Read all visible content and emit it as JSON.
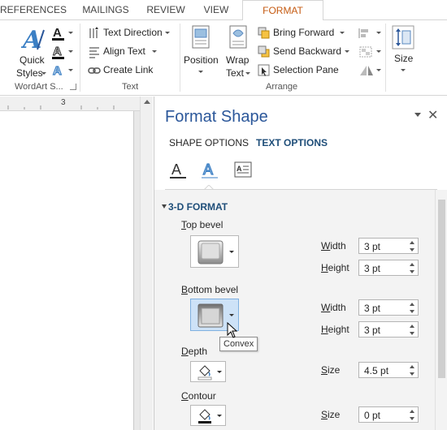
{
  "tabs": [
    {
      "label": "REFERENCES",
      "active": false
    },
    {
      "label": "MAILINGS",
      "active": false
    },
    {
      "label": "REVIEW",
      "active": false
    },
    {
      "label": "VIEW",
      "active": false
    },
    {
      "label": "FORMAT",
      "active": true
    }
  ],
  "ribbon": {
    "wordart": {
      "quick_styles_line1": "Quick",
      "quick_styles_line2": "Styles",
      "group_label": "WordArt S..."
    },
    "text": {
      "text_direction": "Text Direction",
      "align_text": "Align Text",
      "create_link": "Create Link",
      "group_label": "Text"
    },
    "arrange": {
      "position": "Position",
      "wrap_line1": "Wrap",
      "wrap_line2": "Text",
      "bring_forward": "Bring Forward",
      "send_backward": "Send Backward",
      "selection_pane": "Selection Pane",
      "group_label": "Arrange"
    },
    "size": {
      "label": "Size"
    }
  },
  "ruler": {
    "number": "3"
  },
  "pane": {
    "title": "Format Shape",
    "subtabs": [
      {
        "label": "SHAPE OPTIONS",
        "active": false
      },
      {
        "label": "TEXT OPTIONS",
        "active": true
      }
    ],
    "section": "3-D FORMAT",
    "top_bevel": {
      "label_first": "T",
      "label_rest": "op bevel",
      "width_label_first": "W",
      "width_label_rest": "idth",
      "width": "3 pt",
      "height_label_first": "H",
      "height_label_rest": "eight",
      "height": "3 pt"
    },
    "bottom_bevel": {
      "label_first": "B",
      "label_rest": "ottom bevel",
      "width_label_first": "W",
      "width_label_rest": "idth",
      "width": "3 pt",
      "height_label_first": "H",
      "height_label_rest": "eight",
      "height": "3 pt",
      "tooltip": "Convex"
    },
    "depth": {
      "label_first": "D",
      "label_rest": "epth",
      "size_label_first": "S",
      "size_label_rest": "ize",
      "size": "4.5 pt"
    },
    "contour": {
      "label_first": "C",
      "label_rest": "ontour",
      "size_label_first": "S",
      "size_label_rest": "ize",
      "size": "0 pt"
    }
  },
  "colors": {
    "accent": "#2b579a",
    "format_tab": "#c55a11",
    "section": "#1f4e79",
    "hover": "#cde2f7"
  }
}
